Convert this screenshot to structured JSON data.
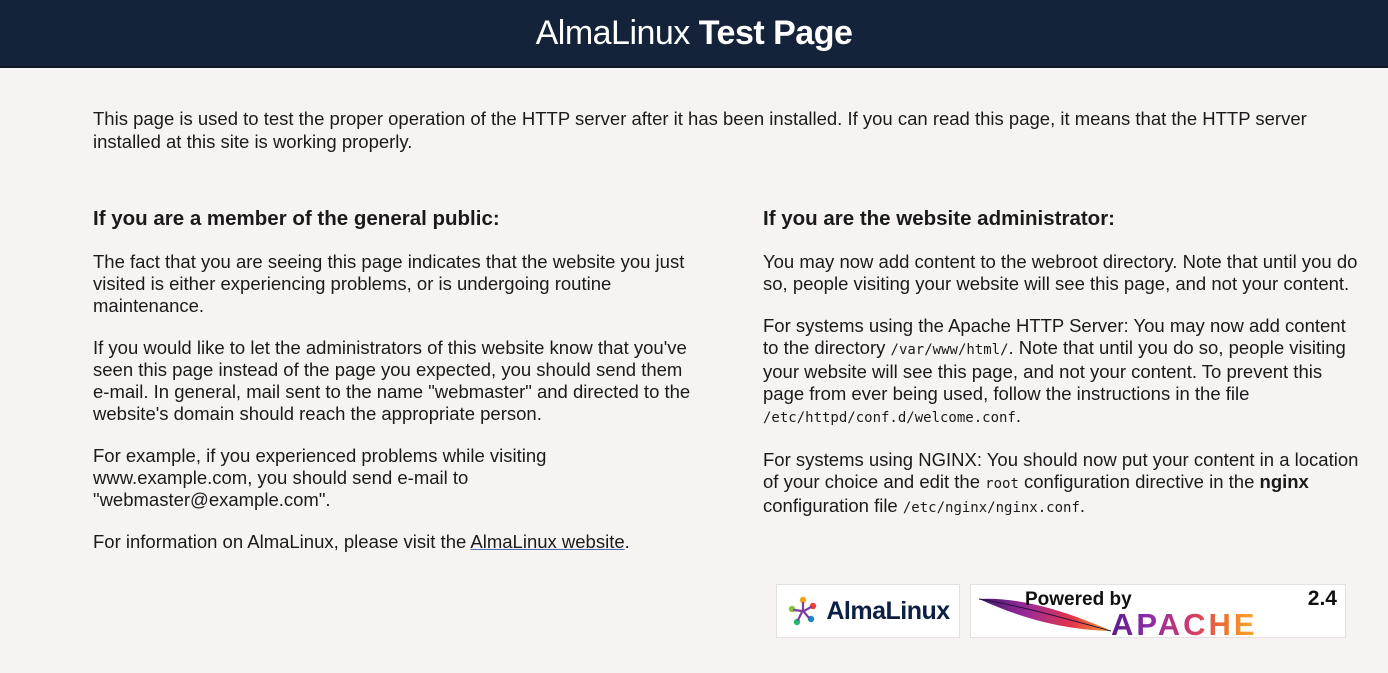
{
  "header": {
    "title_regular": "AlmaLinux",
    "title_bold": "Test Page"
  },
  "intro": "This page is used to test the proper operation of the HTTP server after it has been installed. If you can read this page, it means that the HTTP server installed at this site is working properly.",
  "public": {
    "heading": "If you are a member of the general public:",
    "p1": "The fact that you are seeing this page indicates that the website you just visited is either experiencing problems, or is undergoing routine maintenance.",
    "p2": "If you would like to let the administrators of this website know that you've seen this page instead of the page you expected, you should send them e-mail. In general, mail sent to the name \"webmaster\" and directed to the website's domain should reach the appropriate person.",
    "p3": "For example, if you experienced problems while visiting www.example.com, you should send e-mail to \"webmaster@example.com\".",
    "p4_prefix": "For information on AlmaLinux, please visit the ",
    "p4_link": "AlmaLinux website",
    "p4_suffix": "."
  },
  "admin": {
    "heading": "If you are the website administrator:",
    "p1": "You may now add content to the webroot directory. Note that until you do so, people visiting your website will see this page, and not your content.",
    "p2_a": "For systems using the Apache HTTP Server: You may now add content to the directory ",
    "p2_code1": "/var/www/html/",
    "p2_b": ". Note that until you do so, people visiting your website will see this page, and not your content. To prevent this page from ever being used, follow the instructions in the file ",
    "p2_code2": "/etc/httpd/conf.d/welcome.conf",
    "p2_c": ".",
    "p3_a": "For systems using NGINX: You should now put your content in a location of your choice and edit the ",
    "p3_code1": "root",
    "p3_b": " configuration directive in the ",
    "p3_bold": "nginx",
    "p3_c": " configuration file ",
    "p3_code2": "/etc/nginx/nginx.conf",
    "p3_d": "."
  },
  "badges": {
    "almalinux": "AlmaLinux",
    "apache_powered": "Powered by",
    "apache_version": "2.4",
    "apache_word": "APACHE"
  }
}
